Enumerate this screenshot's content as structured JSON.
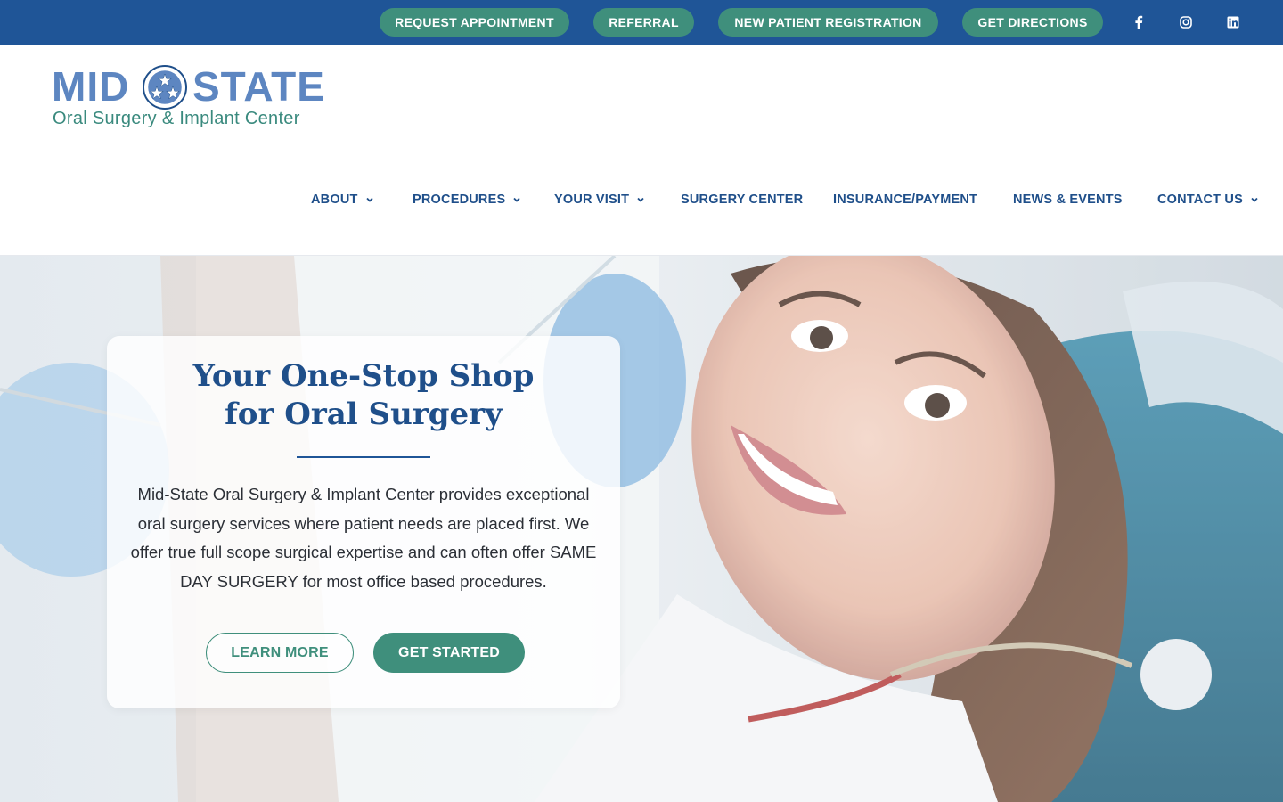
{
  "topbar": {
    "buttons": [
      {
        "label": "REQUEST APPOINTMENT"
      },
      {
        "label": "REFERRAL"
      },
      {
        "label": "NEW PATIENT REGISTRATION"
      },
      {
        "label": "GET DIRECTIONS"
      }
    ],
    "social": [
      "facebook-icon",
      "instagram-icon",
      "linkedin-icon"
    ],
    "bg_color": "#1f5597",
    "button_color": "#3f8f7c"
  },
  "logo": {
    "word1": "MID",
    "word2": "STATE",
    "subtitle": "Oral Surgery & Implant Center"
  },
  "nav": {
    "items": [
      {
        "label": "ABOUT",
        "has_dropdown": true
      },
      {
        "label": "PROCEDURES",
        "has_dropdown": true
      },
      {
        "label": "YOUR VISIT",
        "has_dropdown": true
      },
      {
        "label": "SURGERY CENTER",
        "has_dropdown": false
      },
      {
        "label": "INSURANCE/PAYMENT",
        "has_dropdown": false
      },
      {
        "label": "NEWS & EVENTS",
        "has_dropdown": false
      },
      {
        "label": "CONTACT US",
        "has_dropdown": true
      }
    ]
  },
  "hero": {
    "title_line1": "Your One-Stop Shop",
    "title_line2": "for Oral Surgery",
    "body": "Mid-State Oral Surgery & Implant Center provides exceptional oral surgery services where patient needs are placed first. We offer true full scope surgical expertise and can often offer SAME DAY SURGERY for most office based procedures.",
    "learn_more": "LEARN MORE",
    "get_started": "GET STARTED",
    "image": "smiling-patient-in-dental-chair"
  }
}
